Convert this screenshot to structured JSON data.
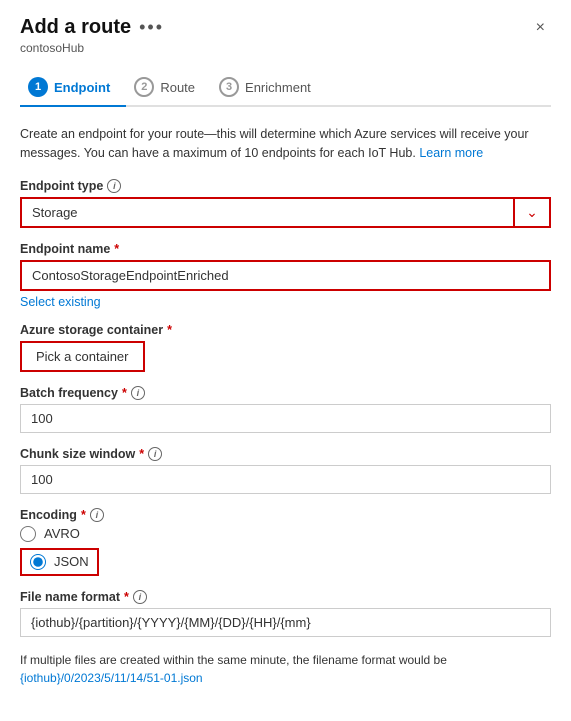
{
  "panel": {
    "title": "Add a route",
    "more_icon": "•••",
    "subtitle": "contosoHub",
    "close_label": "×"
  },
  "steps": [
    {
      "number": "1",
      "label": "Endpoint",
      "active": true
    },
    {
      "number": "2",
      "label": "Route",
      "active": false
    },
    {
      "number": "3",
      "label": "Enrichment",
      "active": false
    }
  ],
  "description": "Create an endpoint for your route—this will determine which Azure services will receive your messages. You can have a maximum of 10 endpoints for each IoT Hub.",
  "learn_more_label": "Learn more",
  "endpoint_type": {
    "label": "Endpoint type",
    "value": "Storage",
    "required": true
  },
  "endpoint_name": {
    "label": "Endpoint name",
    "value": "ContosoStorageEndpointEnriched",
    "required": true,
    "placeholder": ""
  },
  "select_existing_label": "Select existing",
  "azure_storage_container": {
    "label": "Azure storage container",
    "required": true
  },
  "pick_container_btn": "Pick a container",
  "batch_frequency": {
    "label": "Batch frequency",
    "value": "100",
    "required": true
  },
  "chunk_size_window": {
    "label": "Chunk size window",
    "value": "100",
    "required": true
  },
  "encoding": {
    "label": "Encoding",
    "required": true,
    "options": [
      {
        "value": "AVRO",
        "label": "AVRO",
        "selected": false
      },
      {
        "value": "JSON",
        "label": "JSON",
        "selected": true
      }
    ]
  },
  "file_name_format": {
    "label": "File name format",
    "value": "{iothub}/{partition}/{YYYY}/{MM}/{DD}/{HH}/{mm}",
    "required": true
  },
  "footer_text": "If multiple files are created within the same minute, the filename format would be",
  "footer_example": "{iothub}/0/2023/5/11/14/51-01.json",
  "icons": {
    "info": "i",
    "chevron_down": "⌄",
    "close": "✕"
  }
}
